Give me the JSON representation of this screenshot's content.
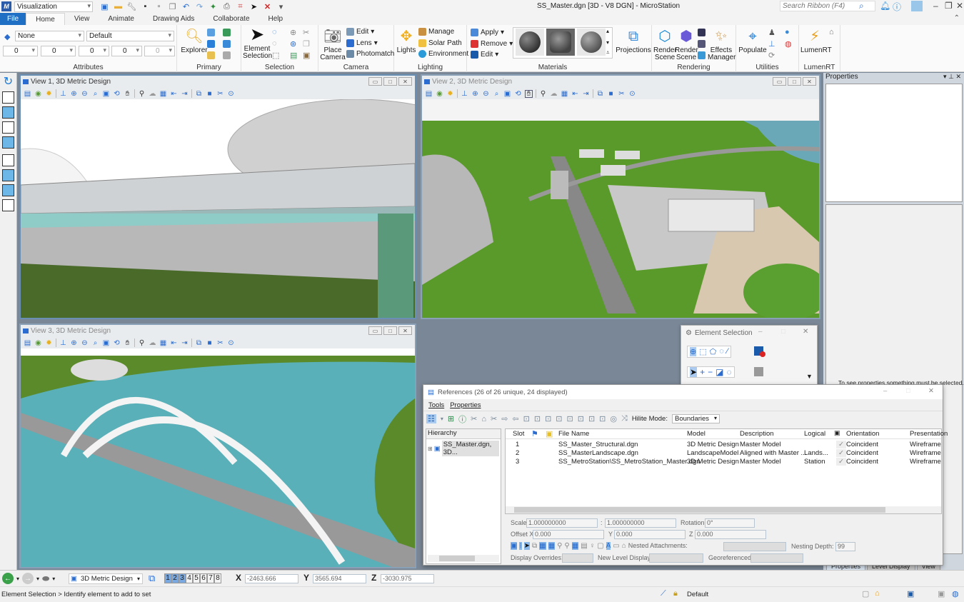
{
  "app": {
    "workflow": "Visualization",
    "window_title": "SS_Master.dgn [3D - V8 DGN] - MicroStation",
    "search_placeholder": "Search Ribbon (F4)",
    "logo_label": "M"
  },
  "tabs": [
    "File",
    "Home",
    "View",
    "Animate",
    "Drawing Aids",
    "Collaborate",
    "Help"
  ],
  "ribbon": {
    "attributes": {
      "label": "Attributes",
      "level": "None",
      "style": "Default",
      "color": "0",
      "weight": "0",
      "linestyle": "0",
      "transparency": "0",
      "priority": "0"
    },
    "primary": {
      "label": "Primary",
      "explorer": "Explorer"
    },
    "selection": {
      "label": "Selection",
      "element_selection_line1": "Element",
      "element_selection_line2": "Selection"
    },
    "camera": {
      "label": "Camera",
      "place_line1": "Place",
      "place_line2": "Camera",
      "edit": "Edit",
      "lens": "Lens",
      "photomatch": "Photomatch"
    },
    "lighting": {
      "label": "Lighting",
      "lights": "Lights",
      "manage": "Manage",
      "solar_path": "Solar Path",
      "environment": "Environment"
    },
    "materials": {
      "label": "Materials",
      "apply": "Apply",
      "remove": "Remove",
      "edit": "Edit"
    },
    "projections": {
      "label": "Projections"
    },
    "rendering": {
      "label": "Rendering",
      "render1_l1": "Render",
      "render1_l2": "Scene",
      "render2_l1": "Render",
      "render2_l2": "Scene",
      "effects_l1": "Effects",
      "effects_l2": "Manager"
    },
    "utilities": {
      "label": "Utilities",
      "populate": "Populate"
    },
    "lumenrt": {
      "label": "LumenRT",
      "lumenrt": "LumenRT"
    }
  },
  "views": [
    {
      "title": "View 1, 3D Metric Design",
      "active": true
    },
    {
      "title": "View 2, 3D Metric Design",
      "active": false
    },
    {
      "title": "View 3, 3D Metric Design",
      "active": false
    }
  ],
  "properties_panel": {
    "title": "Properties",
    "empty_message": "To see properties something must be selected.",
    "tabs": [
      "Properties",
      "Level Display",
      "View"
    ]
  },
  "element_selection": {
    "title": "Element Selection"
  },
  "references": {
    "title": "References (26 of 26 unique, 24 displayed)",
    "menu": [
      "Tools",
      "Properties"
    ],
    "hilite_label": "Hilite Mode:",
    "hilite_value": "Boundaries",
    "hierarchy_header": "Hierarchy",
    "hierarchy_item": "SS_Master.dgn, 3D...",
    "columns": [
      "Slot",
      "",
      "",
      "File Name",
      "Model",
      "Description",
      "Logical",
      "",
      "Orientation",
      "Presentation"
    ],
    "rows": [
      {
        "slot": "1",
        "file": "SS_Master_Structural.dgn",
        "model": "3D Metric Design",
        "description": "Master Model",
        "logical": "",
        "check": "✓",
        "orientation": "Coincident",
        "presentation": "Wireframe"
      },
      {
        "slot": "2",
        "file": "SS_MasterLandscape.dgn",
        "model": "LandscapeModel",
        "description": "Aligned with Master ...",
        "logical": "Lands...",
        "check": "✓",
        "orientation": "Coincident",
        "presentation": "Wireframe"
      },
      {
        "slot": "3",
        "file": "SS_MetroStation\\SS_MetroStation_Master.dgn",
        "model": "3D Metric Design",
        "description": "Master Model",
        "logical": "Station",
        "check": "✓",
        "orientation": "Coincident",
        "presentation": "Wireframe"
      }
    ],
    "scale_label": "Scale",
    "scale1": "1.000000000",
    "scale_sep": ":",
    "scale2": "1.000000000",
    "rotation_label": "Rotation",
    "rotation": "0°",
    "offset_x_label": "Offset X",
    "offset_x": "0.000",
    "y_label": "Y",
    "offset_y": "0.000",
    "z_label": "Z",
    "offset_z": "0.000",
    "nested_label": "Nested Attachments:",
    "nesting_depth_label": "Nesting Depth:",
    "nesting_depth": "99",
    "display_overrides_label": "Display Overrides:",
    "new_level_display_label": "New Level Display:",
    "georeferenced_label": "Georeferenced:"
  },
  "statusbar": {
    "model": "3D Metric Design",
    "view_numbers": [
      "1",
      "2",
      "3",
      "4",
      "5",
      "6",
      "7",
      "8"
    ],
    "active_views": [
      1,
      2,
      3
    ],
    "x_label": "X",
    "x": "-2463.666",
    "y_label": "Y",
    "y": "3565.694",
    "z_label": "Z",
    "z": "-3030.975",
    "prompt": "Element Selection > Identify element to add to set",
    "level": "Default"
  }
}
